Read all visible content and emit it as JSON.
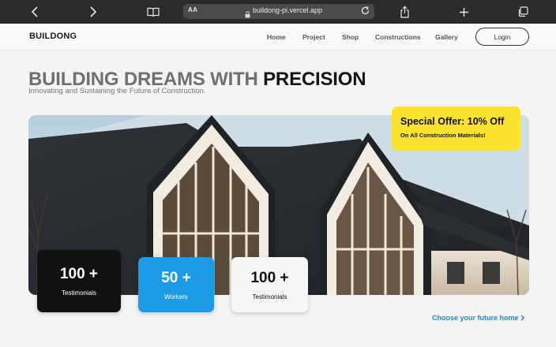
{
  "browser": {
    "address": "buildong-pi.vercel.app",
    "reader_label": "AA"
  },
  "nav": {
    "brand": "BUILDONG",
    "links": [
      "Home",
      "Project",
      "Shop",
      "Constructions",
      "Gallery"
    ],
    "login": "Login"
  },
  "hero": {
    "headline_muted": "BUILDING DREAMS WITH",
    "headline_bold": "PRECISION",
    "subtitle": "Innovating and Sustaining the Future of Construction."
  },
  "offer": {
    "title": "Special Offer: 10% Off",
    "subtitle": "On All Construction Materials!",
    "color": "#fde32e"
  },
  "stats": [
    {
      "value": "100 +",
      "label": "Testimonials",
      "color": "#111111"
    },
    {
      "value": "50 +",
      "label": "Workers",
      "color": "#1d9be6"
    },
    {
      "value": "100 +",
      "label": "Testimonials",
      "color": "#f7f7f7"
    }
  ],
  "cta": {
    "text": "Choose your future home",
    "color": "#2a86c8"
  },
  "icons": {
    "back": "chevron-left-icon",
    "forward": "chevron-right-icon",
    "bookmarks": "book-icon",
    "lock": "lock-icon",
    "reload": "reload-icon",
    "share": "share-icon",
    "new_tab": "plus-icon",
    "tabs": "tabs-icon",
    "cta_arrow": "chevron-right-icon"
  }
}
